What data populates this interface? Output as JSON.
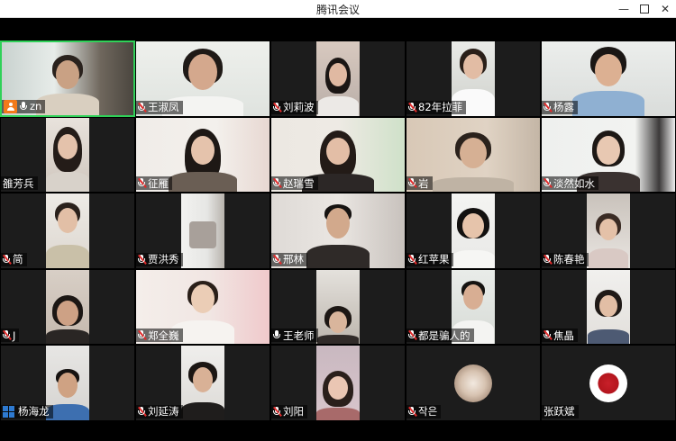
{
  "window": {
    "title": "腾讯会议",
    "minimize_glyph": "—",
    "close_glyph": "✕"
  },
  "participants": [
    {
      "name": "zn",
      "mic": "on",
      "host": true
    },
    {
      "name": "王淑凤",
      "mic": "muted"
    },
    {
      "name": "刘莉波",
      "mic": "muted"
    },
    {
      "name": "82年拉菲",
      "mic": "muted"
    },
    {
      "name": "杨露",
      "mic": "muted"
    },
    {
      "name": "雒芳兵",
      "mic": "none"
    },
    {
      "name": "征雁",
      "mic": "muted"
    },
    {
      "name": "赵瑞雪",
      "mic": "muted"
    },
    {
      "name": "岩",
      "mic": "muted"
    },
    {
      "name": "淡然如水",
      "mic": "muted"
    },
    {
      "name": "简",
      "mic": "muted"
    },
    {
      "name": "贾洪秀",
      "mic": "muted"
    },
    {
      "name": "邢林",
      "mic": "muted"
    },
    {
      "name": "红苹果",
      "mic": "muted"
    },
    {
      "name": "陈春艳",
      "mic": "muted"
    },
    {
      "name": "J",
      "mic": "muted"
    },
    {
      "name": "郑全巍",
      "mic": "muted"
    },
    {
      "name": "王老师",
      "mic": "on"
    },
    {
      "name": "都是骗人的",
      "mic": "muted"
    },
    {
      "name": "焦晶",
      "mic": "muted"
    },
    {
      "name": "杨海龙",
      "mic": "none",
      "sharing": true
    },
    {
      "name": "刘延涛",
      "mic": "muted"
    },
    {
      "name": "刘阳",
      "mic": "muted"
    },
    {
      "name": "작은",
      "mic": "muted"
    },
    {
      "name": "张跃斌",
      "mic": "none"
    }
  ],
  "icons": {
    "mic": "microphone-icon",
    "mic_muted": "microphone-muted-icon",
    "host": "host-badge-icon",
    "share": "screen-share-icon",
    "minimize": "minimize-icon",
    "maximize": "maximize-icon",
    "close": "close-icon"
  },
  "colors": {
    "active_speaker_border": "#2fd158",
    "muted_slash": "#e02b2b",
    "host_badge": "#f27a1a",
    "background": "#000000"
  }
}
